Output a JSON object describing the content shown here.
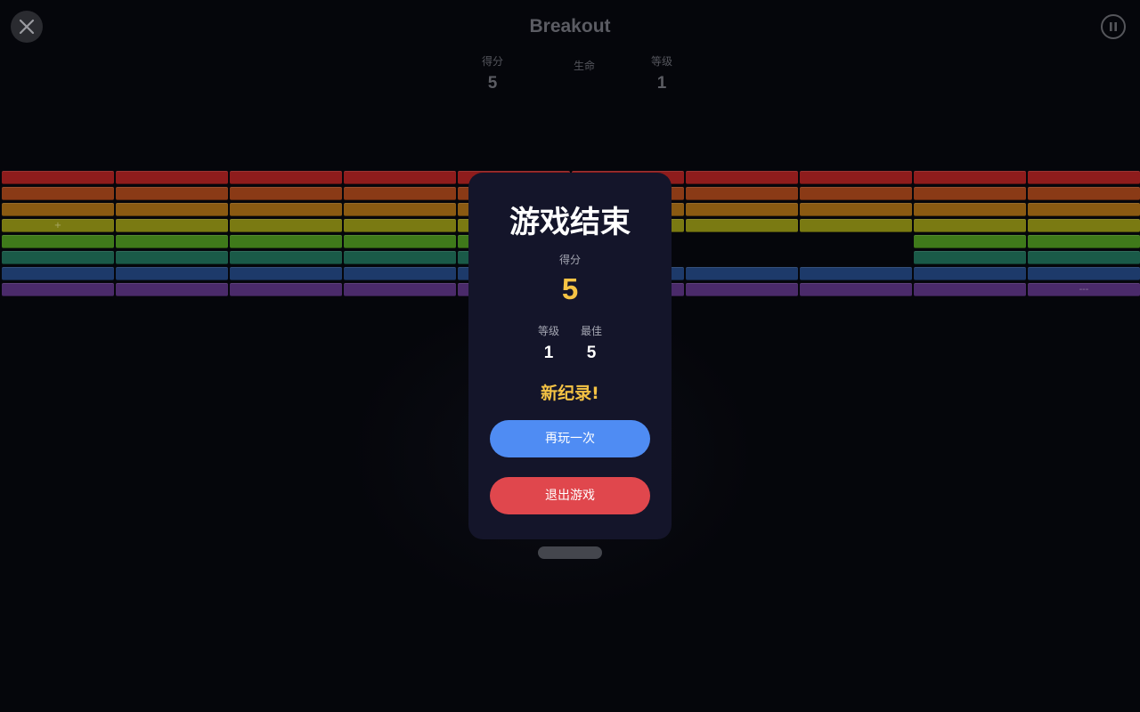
{
  "header": {
    "title": "Breakout",
    "close_icon": "close-icon",
    "pause_icon": "pause-icon"
  },
  "stats": {
    "score_label": "得分",
    "score_value": "5",
    "lives_label": "生命",
    "level_label": "等级",
    "level_value": "1"
  },
  "bricks": {
    "columns": 10,
    "row_colors": [
      "#8e1c1c",
      "#8a3a16",
      "#8a5a12",
      "#7a7a12",
      "#3f7a1a",
      "#1a5a48",
      "#1d3a6a",
      "#4a2a6a"
    ],
    "broken": [
      [
        4,
        5
      ],
      [
        4,
        6
      ],
      [
        4,
        7
      ],
      [
        5,
        5
      ],
      [
        5,
        6
      ],
      [
        5,
        7
      ]
    ],
    "powerup_marks": [
      {
        "row": 3,
        "col": 0,
        "glyph": "+"
      },
      {
        "row": 7,
        "col": 9,
        "glyph": "---"
      }
    ]
  },
  "modal": {
    "title": "游戏结束",
    "score_label": "得分",
    "score_value": "5",
    "level_label": "等级",
    "level_value": "1",
    "best_label": "最佳",
    "best_value": "5",
    "new_record": "新纪录!",
    "replay_label": "再玩一次",
    "quit_label": "退出游戏"
  },
  "colors": {
    "background": "#05060b",
    "modal_bg": "#14152a",
    "accent_gold": "#f5c344",
    "replay_blue": "#4f8cf3",
    "quit_red": "#e0474d"
  }
}
